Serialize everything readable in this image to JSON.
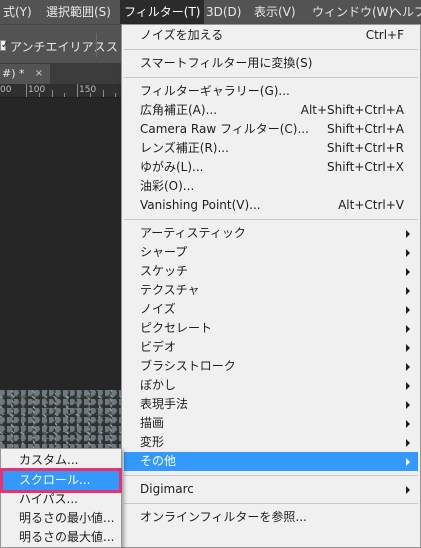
{
  "menubar": {
    "items": [
      "式(Y)",
      "選択範囲(S)",
      "フィルター(T)",
      "3D(D)",
      "表示(V)",
      "ウィンドウ(W)",
      "ヘルプ"
    ],
    "active_index": 2
  },
  "options_bar": {
    "antialias_label": "アンチエイリアス",
    "truncated_label": "ス"
  },
  "document": {
    "tab_label": "#) *",
    "tab_close": "×",
    "ruler_labels": [
      "00",
      "100",
      "150"
    ]
  },
  "filter_menu": {
    "add_noise": "ノイズを加える",
    "add_noise_shortcut": "Ctrl+F",
    "convert_smart": "スマートフィルター用に変換(S)",
    "gallery": "フィルターギャラリー(G)...",
    "adaptive_wide_angle": "広角補正(A)...",
    "adaptive_wide_angle_shortcut": "Alt+Shift+Ctrl+A",
    "camera_raw": "Camera Raw フィルター(C)...",
    "camera_raw_shortcut": "Shift+Ctrl+A",
    "lens_correction": "レンズ補正(R)...",
    "lens_correction_shortcut": "Shift+Ctrl+R",
    "liquify": "ゆがみ(L)...",
    "liquify_shortcut": "Shift+Ctrl+X",
    "oil_paint": "油彩(O)...",
    "vanishing_point": "Vanishing Point(V)...",
    "vanishing_point_shortcut": "Alt+Ctrl+V",
    "submenus": [
      "アーティスティック",
      "シャープ",
      "スケッチ",
      "テクスチャ",
      "ノイズ",
      "ピクセレート",
      "ビデオ",
      "ブラシストローク",
      "ぼかし",
      "表現手法",
      "描画",
      "変形",
      "その他"
    ],
    "highlighted_submenu_index": 12,
    "digimarc": "Digimarc",
    "online_filters": "オンラインフィルターを参照..."
  },
  "other_submenu": {
    "items": [
      "カスタム...",
      "スクロール...",
      "ハイパス...",
      "明るさの最小値...",
      "明るさの最大値..."
    ],
    "highlighted_index": 1
  },
  "colors": {
    "menu_highlight": "#3399ff",
    "annotation_outline": "#e8326e",
    "menubar_bg": "#535353"
  }
}
